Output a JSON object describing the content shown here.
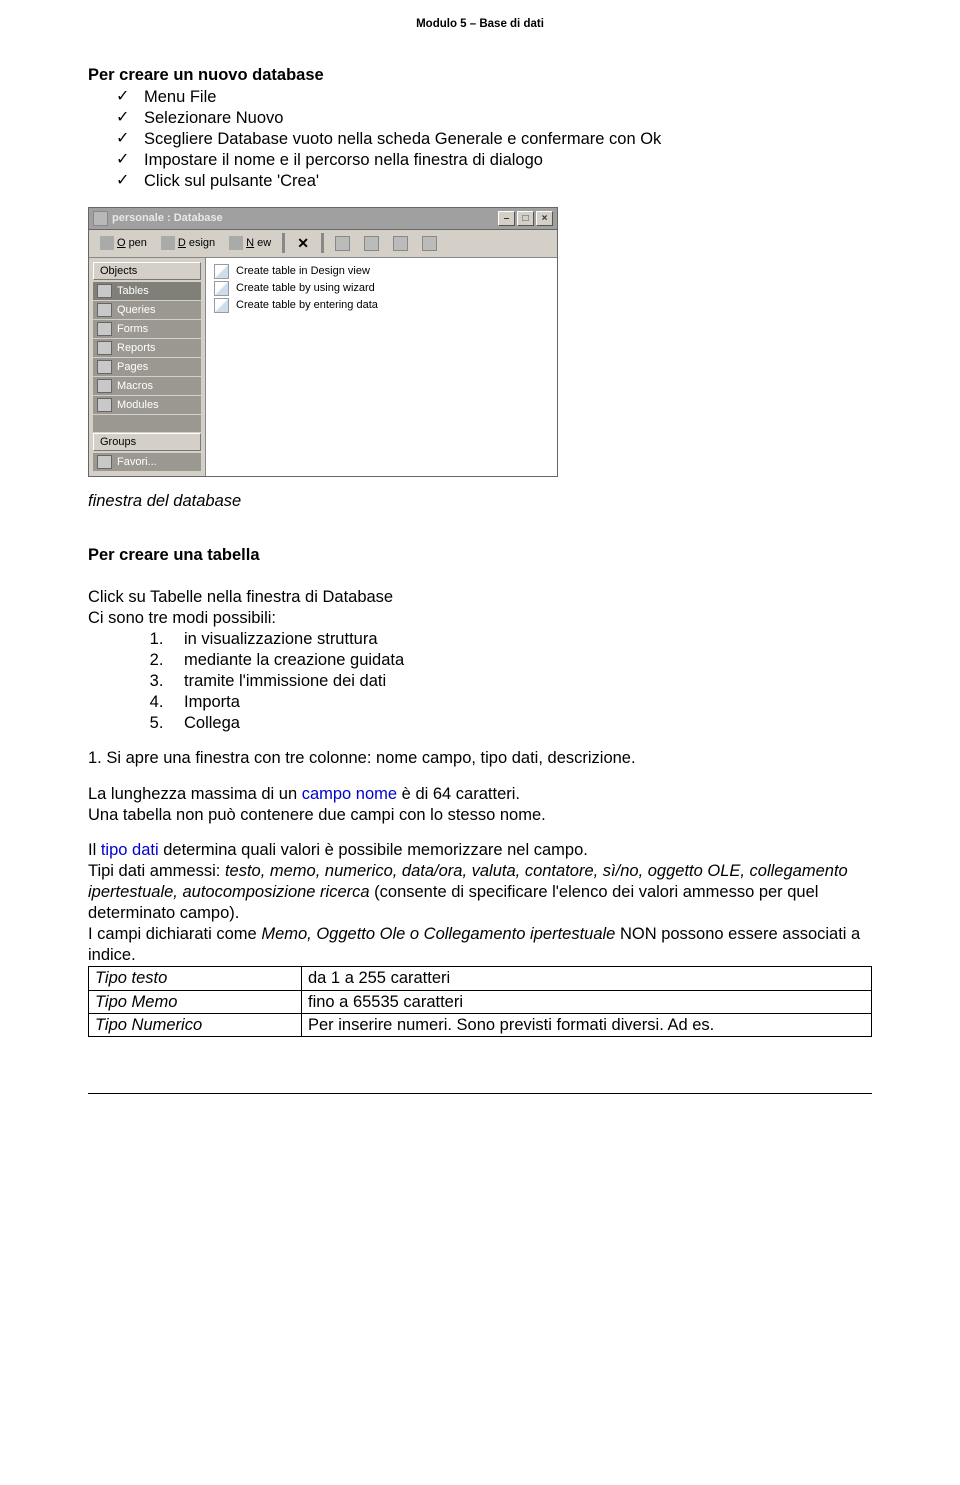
{
  "header": {
    "module_title": "Modulo 5 – Base di dati"
  },
  "section1": {
    "heading": "Per creare un nuovo database",
    "steps": [
      "Menu File",
      "Selezionare Nuovo",
      "Scegliere Database vuoto nella scheda Generale e confermare con Ok",
      "Impostare il nome e il percorso nella finestra di dialogo",
      "Click sul pulsante  'Crea'"
    ]
  },
  "mock": {
    "title": "personale : Database",
    "toolbar": {
      "open": "Open",
      "design": "Design",
      "new": "New"
    },
    "sidebar": {
      "objects_label": "Objects",
      "items": [
        "Tables",
        "Queries",
        "Forms",
        "Reports",
        "Pages",
        "Macros",
        "Modules"
      ],
      "groups_label": "Groups",
      "favorites": "Favori..."
    },
    "list_items": [
      "Create table in Design view",
      "Create table by using wizard",
      "Create table by entering data"
    ]
  },
  "caption1": "finestra del database",
  "section2": {
    "heading": "Per creare una tabella",
    "intro_line1": "Click su Tabelle nella finestra di Database",
    "intro_line2": "Ci sono tre modi possibili:",
    "steps": [
      "in visualizzazione struttura",
      "mediante la creazione guidata",
      "tramite l'immissione dei dati",
      "Importa",
      "Collega"
    ]
  },
  "paragraphs": {
    "p1": "1. Si apre una finestra con tre colonne: nome campo, tipo dati, descrizione.",
    "p2_a": "La lunghezza massima di un ",
    "p2_b": "campo nome",
    "p2_c": " è di 64 caratteri.",
    "p3": "Una tabella non può contenere due campi con lo stesso nome.",
    "p4_a": "Il ",
    "p4_b": "tipo dati",
    "p4_c": " determina quali valori è possibile memorizzare nel campo.",
    "p5_a": "Tipi dati ammessi: ",
    "p5_b": "testo, memo, numerico, data/ora, valuta, contatore, sì/no, oggetto OLE, collegamento ipertestuale, autocomposizione ricerca",
    "p5_c": " (consente di specificare l'elenco dei valori ammesso per quel determinato campo).",
    "p6_a": "I campi dichiarati come ",
    "p6_b": "Memo, Oggetto Ole o Collegamento ipertestuale",
    "p6_c": " NON possono essere associati a indice."
  },
  "type_table": {
    "rows": [
      {
        "type": "Tipo testo",
        "desc": "da 1 a 255 caratteri"
      },
      {
        "type": "Tipo Memo",
        "desc": "fino a 65535 caratteri"
      },
      {
        "type": "Tipo Numerico",
        "desc": "Per inserire numeri. Sono previsti formati diversi. Ad es."
      }
    ]
  }
}
